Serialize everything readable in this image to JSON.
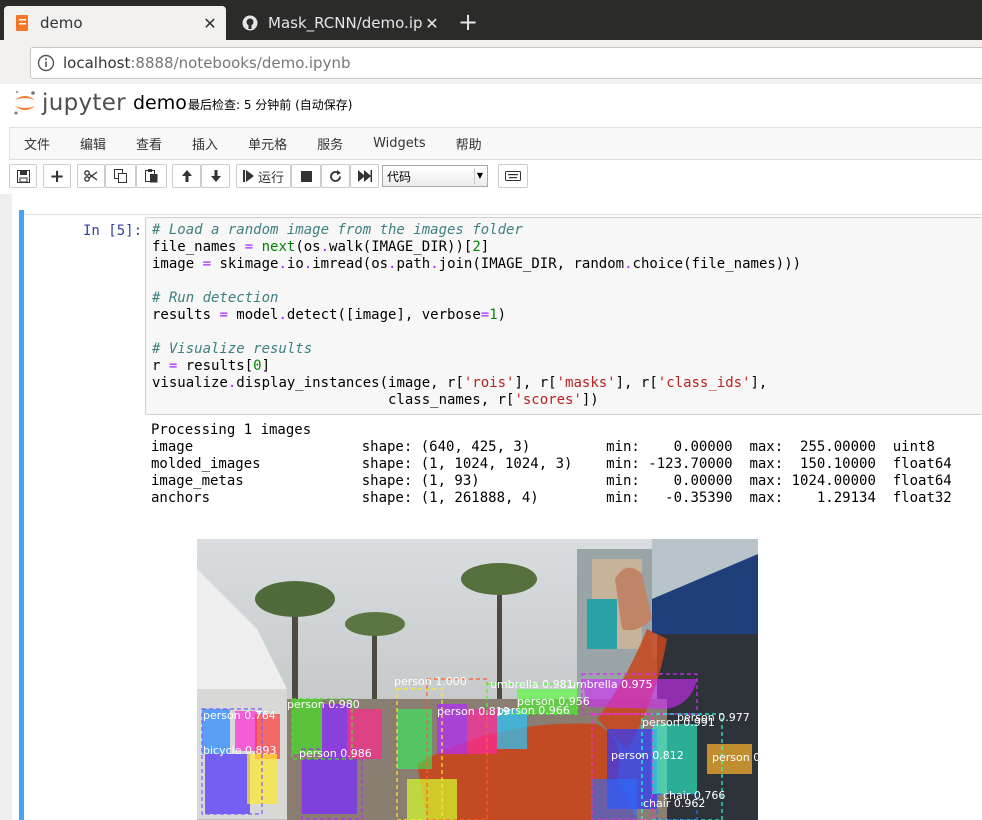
{
  "browser": {
    "tabs": [
      {
        "title": "demo",
        "close": "✕"
      },
      {
        "title": "Mask_RCNN/demo.ipynb",
        "close": "✕"
      }
    ],
    "new_tab": "+",
    "url_host": "localhost",
    "url_rest": ":8888/notebooks/demo.ipynb"
  },
  "header": {
    "logo_text": "jupyter",
    "notebook_name": "demo",
    "checkpoint": "最后检查: 5 分钟前  (自动保存)"
  },
  "menu": [
    "文件",
    "编辑",
    "查看",
    "插入",
    "单元格",
    "服务",
    "Widgets",
    "帮助"
  ],
  "toolbar": {
    "run_label": "运行",
    "cell_type": "代码"
  },
  "cell": {
    "prompt": "In [5]:",
    "output_lines": [
      "Processing 1 images",
      "image                    shape: (640, 425, 3)         min:    0.00000  max:  255.00000  uint8",
      "molded_images            shape: (1, 1024, 1024, 3)    min: -123.70000  max:  150.10000  float64",
      "image_metas              shape: (1, 93)               min:    0.00000  max: 1024.00000  float64",
      "anchors                  shape: (1, 261888, 4)        min:   -0.35390  max:    1.29134  float32"
    ]
  },
  "code_tokens": {
    "c1": "# Load a random image from the images folder",
    "l2a": "file_names ",
    "op": "=",
    "l2b": " ",
    "next": "next",
    "l2c": "(os",
    "dot": ".",
    "l2d": "walk(IMAGE_DIR))[",
    "n2": "2",
    "l2e": "]",
    "l3a": "image ",
    "l3b": " skimage",
    "l3c": "io",
    "l3d": "imread(os",
    "l3e": "path",
    "l3f": "join(IMAGE_DIR, random",
    "l3g": "choice(file_names)))",
    "c2": "# Run detection",
    "l5a": "results ",
    "l5b": " model",
    "l5c": "detect([image], verbose",
    "n1": "1",
    "l5d": ")",
    "c3": "# Visualize results",
    "l7a": "r ",
    "l7b": " results[",
    "n0": "0",
    "l7c": "]",
    "l8a": "visualize",
    "l8b": "display_instances(image, r[",
    "s_rois": "'rois'",
    "l8c": "], r[",
    "s_masks": "'masks'",
    "l8d": "], r[",
    "s_cls": "'class_ids'",
    "l8e": "],",
    "l9a": "                            class_names, r[",
    "s_scores": "'scores'",
    "l9b": "])"
  },
  "detections": [
    "person 1.000",
    "umbrella 0.981",
    "umbrella 0.975",
    "person 0.956",
    "person 0.966",
    "person 0.819",
    "person 0.980",
    "person 0.977",
    "person 0.991",
    "person 0.764",
    "person 0.986",
    "person 0.812",
    "bicycle 0.893",
    "person 0.",
    "chair 0.766",
    "chair 0.962"
  ]
}
